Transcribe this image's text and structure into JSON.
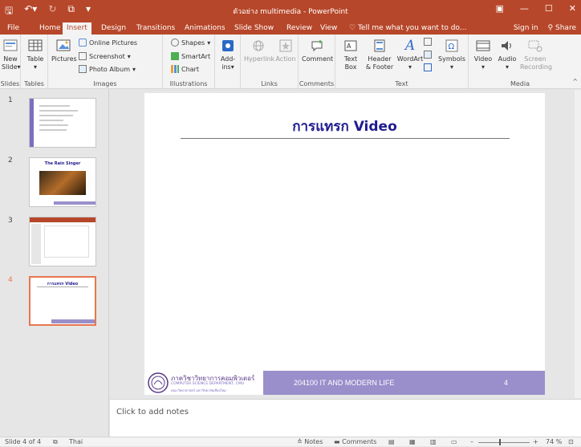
{
  "titlebar": {
    "title": "ตัวอย่าง multimedia - PowerPoint"
  },
  "tabs": [
    {
      "label": "File"
    },
    {
      "label": "Home"
    },
    {
      "label": "Insert"
    },
    {
      "label": "Design"
    },
    {
      "label": "Transitions"
    },
    {
      "label": "Animations"
    },
    {
      "label": "Slide Show"
    },
    {
      "label": "Review"
    },
    {
      "label": "View"
    }
  ],
  "tellme": "Tell me what you want to do...",
  "signin": "Sign in",
  "share": "Share",
  "ribbon": {
    "new_slide": [
      "New",
      "Slide"
    ],
    "table": "Table",
    "pictures": "Pictures",
    "online_pictures": "Online Pictures",
    "screenshot": "Screenshot",
    "photo_album": "Photo Album",
    "shapes": "Shapes",
    "smartart": "SmartArt",
    "chart": "Chart",
    "addins": [
      "Add-",
      "ins"
    ],
    "hyperlink": "Hyperlink",
    "action": "Action",
    "comment": "Comment",
    "textbox": [
      "Text",
      "Box"
    ],
    "header_footer": [
      "Header",
      "& Footer"
    ],
    "wordart": "WordArt",
    "symbols": "Symbols",
    "video": "Video",
    "audio": "Audio",
    "screen_recording": [
      "Screen",
      "Recording"
    ],
    "groups": {
      "slides": "Slides",
      "tables": "Tables",
      "images": "Images",
      "illustrations": "Illustrations",
      "links": "Links",
      "comments": "Comments",
      "text": "Text",
      "media": "Media"
    }
  },
  "thumbs": [
    {
      "num": "1"
    },
    {
      "num": "2",
      "title": "The Rain Singer"
    },
    {
      "num": "3"
    },
    {
      "num": "4",
      "title": "การแทรก Video"
    }
  ],
  "slide": {
    "title": "การแทรก Video",
    "footer_course": "204100  IT AND MODERN LIFE",
    "footer_page": "4",
    "logo_line1": "ภาควิชาวิทยาการคอมพิวเตอร์",
    "logo_line2": "COMPUTER SCIENCE DEPARTMENT, CMU",
    "logo_line3": "คณะวิทยาศาสตร์ มหาวิทยาลัยเชียงใหม่"
  },
  "notes_placeholder": "Click to add notes",
  "status": {
    "slide_of": "Slide 4 of 4",
    "language": "Thai",
    "notes": "Notes",
    "comments": "Comments",
    "zoom": "74 %"
  },
  "colors": {
    "accent": "#b7472a",
    "slide_title": "#1f1b8f",
    "footer_bar": "#9a8fcb"
  }
}
